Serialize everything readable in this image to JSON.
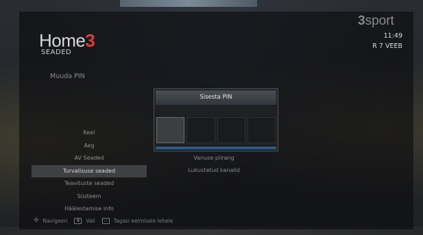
{
  "brand": {
    "name": "Home",
    "mark": "3"
  },
  "page": {
    "title": "SEADED",
    "section": "Muuda PIN"
  },
  "channel": {
    "logo_mark": "3",
    "logo_word": "sport"
  },
  "status": {
    "time": "11:49",
    "date": "R 7 VEEB"
  },
  "menu": {
    "items": [
      {
        "label": "Keel",
        "active": false
      },
      {
        "label": "Aeg",
        "active": false
      },
      {
        "label": "AV Seaded",
        "active": false
      },
      {
        "label": "Turvalisuse seaded",
        "active": true
      },
      {
        "label": "Teavituste seaded",
        "active": false
      },
      {
        "label": "Süsteem",
        "active": false
      },
      {
        "label": "Häälestamise info",
        "active": false
      }
    ]
  },
  "submenu": {
    "items": [
      {
        "label": "Vanuse piirang"
      },
      {
        "label": "Lukustatud kanalid"
      }
    ]
  },
  "dialog": {
    "title": "Sisesta PIN",
    "pin_boxes": 4,
    "active_box": 0
  },
  "footer": {
    "navigate": "Navigeeri",
    "select": "Vali",
    "back": "Tagasi eelmisele lehele"
  },
  "colors": {
    "accent": "#e53935",
    "dialog_bar": "#2c5b8a"
  }
}
